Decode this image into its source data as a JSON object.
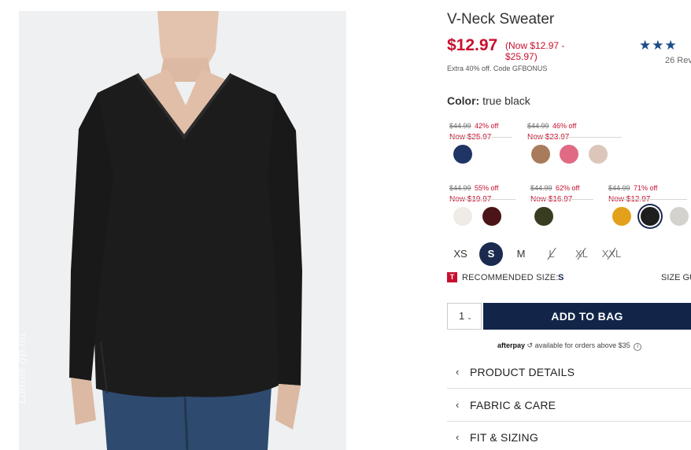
{
  "product": {
    "title": "V-Neck Sweater",
    "price": "$12.97",
    "price_range": "(Now $12.97 - $25.97)",
    "promo": "Extra 40% off. Code GFBONUS",
    "stars": "★★★",
    "reviews": "26 Rev"
  },
  "photo": {
    "watermark": "Ladies.gp.ua"
  },
  "color": {
    "label": "Color:",
    "value": "true black"
  },
  "price_groups": [
    {
      "strike": "$44.99",
      "off": "42% off",
      "now": "Now $25.97"
    },
    {
      "strike": "$44.99",
      "off": "46% off",
      "now": "Now $23.97"
    },
    {
      "strike": "$44.99",
      "off": "55% off",
      "now": "Now $19.97"
    },
    {
      "strike": "$44.99",
      "off": "62% off",
      "now": "Now $16.97"
    },
    {
      "strike": "$44.99",
      "off": "71% off",
      "now": "Now $12.97"
    }
  ],
  "swatch_colors": [
    "#1f3566",
    "#a87c5a",
    "#e06a84",
    "#dcc6bb",
    "#efebe6",
    "#4a1418",
    "#3a3c22",
    "#e3a11b",
    "#1e1e1e",
    "#d4d2cc"
  ],
  "sizes": [
    "XS",
    "S",
    "M",
    "L",
    "XL",
    "XXL"
  ],
  "selected_size": "S",
  "recommended": {
    "badge": "T",
    "label": "RECOMMENDED SIZE:",
    "value": "S",
    "guide": "SIZE GU"
  },
  "cart": {
    "qty": "1",
    "add_label": "ADD TO BAG"
  },
  "afterpay": {
    "logo": "afterpay",
    "text": "available for orders above $35",
    "info": "i"
  },
  "accordions": [
    {
      "label": "PRODUCT DETAILS"
    },
    {
      "label": "FABRIC & CARE"
    },
    {
      "label": "FIT & SIZING"
    }
  ],
  "colors": {
    "sale_red": "#c8102e",
    "navy": "#122549",
    "star_blue": "#1b4b88"
  }
}
